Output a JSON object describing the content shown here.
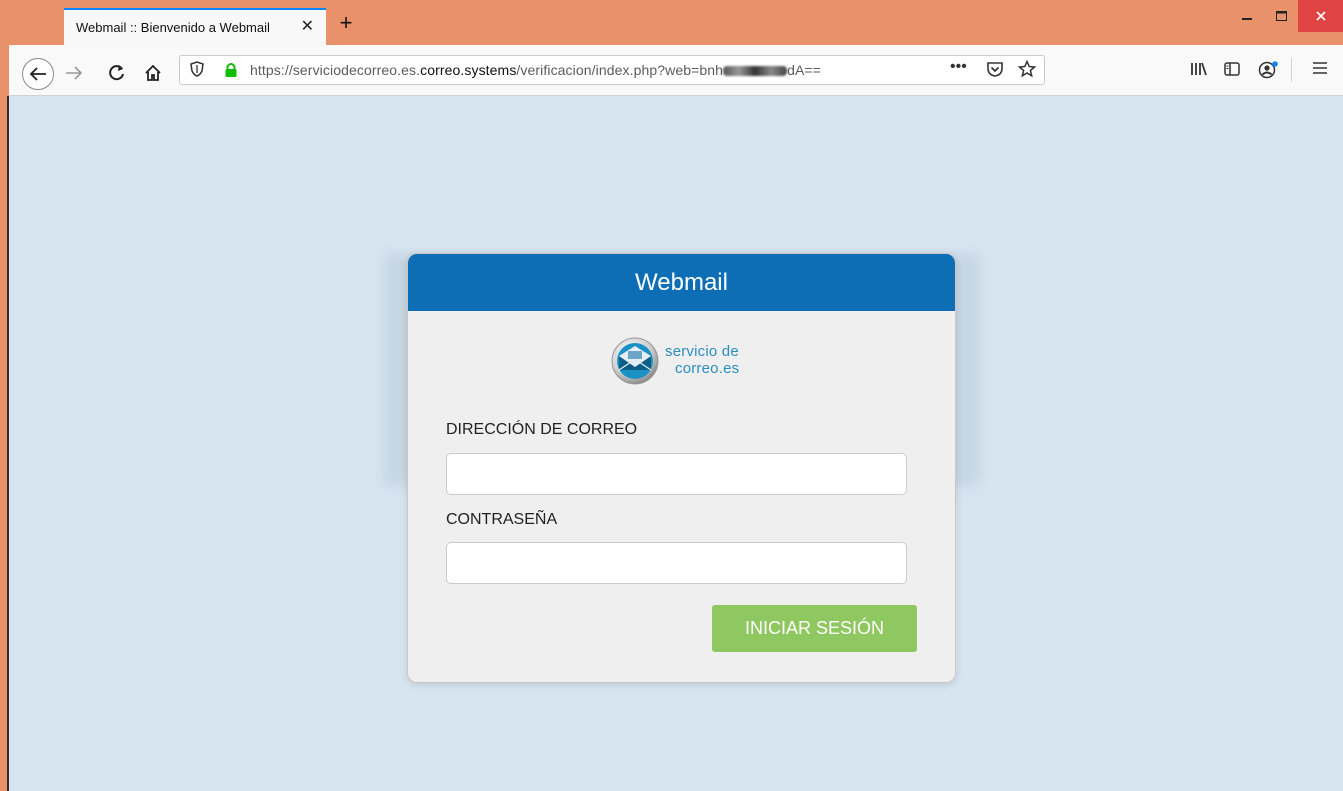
{
  "browser": {
    "tab_title": "Webmail :: Bienvenido a Webmail",
    "tab_close": "✕",
    "new_tab": "+",
    "url_prefix": "https://serviciodecorreo.es.",
    "url_host": "correo.systems",
    "url_path": "/verificacion/index.php?web=bnh",
    "url_suffix": "dA==",
    "page_actions": "•••"
  },
  "login": {
    "header_title": "Webmail",
    "logo_line1": "servicio de",
    "logo_line2": "correo.es",
    "email_label": "DIRECCIÓN DE CORREO",
    "email_value": "",
    "password_label": "CONTRASEÑA",
    "password_value": "",
    "submit_label": "INICIAR SESIÓN"
  },
  "colors": {
    "page_bg": "#d7e5f1",
    "header_blue": "#0d6eb6",
    "button_green": "#8fc761",
    "titlebar_orange": "#e9916a"
  },
  "icons": [
    "back-arrow-icon",
    "forward-arrow-icon",
    "reload-icon",
    "home-icon",
    "tracking-shield-icon",
    "lock-icon",
    "page-actions-icon",
    "pocket-icon",
    "bookmark-star-icon",
    "library-icon",
    "sidebar-icon",
    "account-icon",
    "menu-icon",
    "minimize-icon",
    "maximize-icon",
    "close-icon",
    "envelope-logo-icon"
  ]
}
